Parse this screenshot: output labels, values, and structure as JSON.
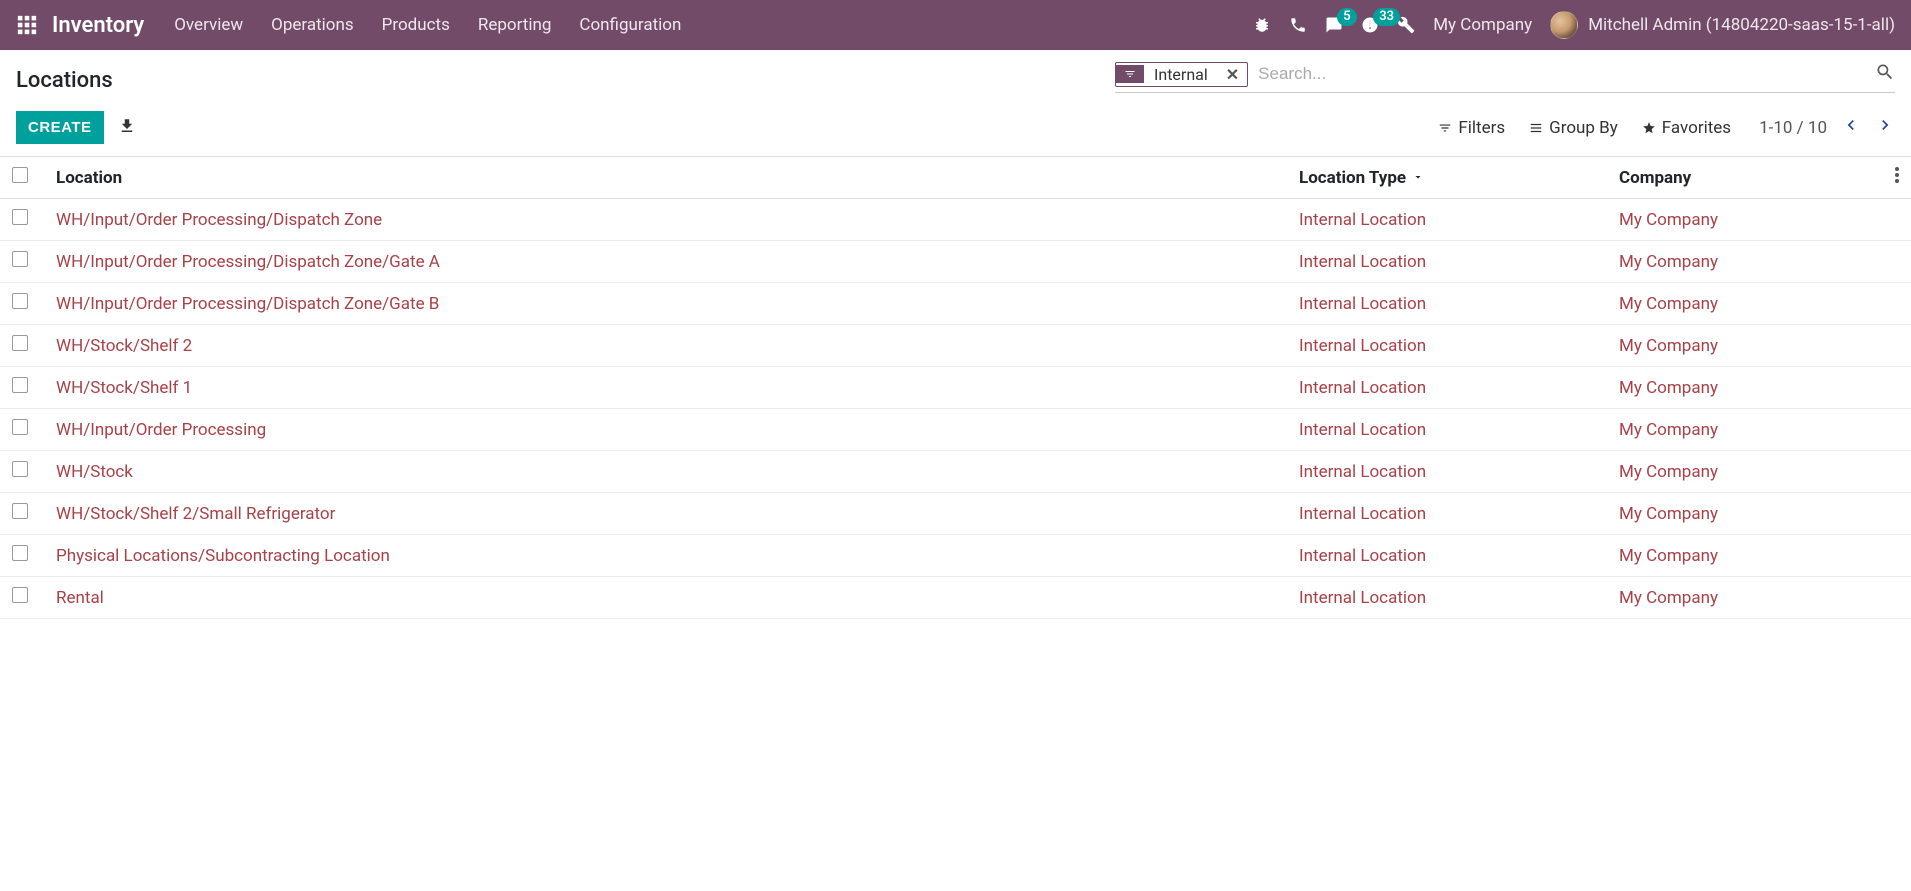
{
  "nav": {
    "brand": "Inventory",
    "menus": [
      "Overview",
      "Operations",
      "Products",
      "Reporting",
      "Configuration"
    ],
    "msg_count": "5",
    "activities_count": "33",
    "company": "My Company",
    "user": "Mitchell Admin (14804220-saas-15-1-all)"
  },
  "page": {
    "title": "Locations",
    "create_btn": "CREATE",
    "search_placeholder": "Search...",
    "facet_label": "Internal",
    "filters_label": "Filters",
    "groupby_label": "Group By",
    "favorites_label": "Favorites",
    "pager_text": "1-10 / 10"
  },
  "table": {
    "headers": {
      "location": "Location",
      "type": "Location Type",
      "company": "Company"
    },
    "rows": [
      {
        "location": "WH/Input/Order Processing/Dispatch Zone",
        "type": "Internal Location",
        "company": "My Company"
      },
      {
        "location": "WH/Input/Order Processing/Dispatch Zone/Gate A",
        "type": "Internal Location",
        "company": "My Company"
      },
      {
        "location": "WH/Input/Order Processing/Dispatch Zone/Gate B",
        "type": "Internal Location",
        "company": "My Company"
      },
      {
        "location": "WH/Stock/Shelf 2",
        "type": "Internal Location",
        "company": "My Company"
      },
      {
        "location": "WH/Stock/Shelf 1",
        "type": "Internal Location",
        "company": "My Company"
      },
      {
        "location": "WH/Input/Order Processing",
        "type": "Internal Location",
        "company": "My Company"
      },
      {
        "location": "WH/Stock",
        "type": "Internal Location",
        "company": "My Company"
      },
      {
        "location": "WH/Stock/Shelf 2/Small Refrigerator",
        "type": "Internal Location",
        "company": "My Company"
      },
      {
        "location": "Physical Locations/Subcontracting Location",
        "type": "Internal Location",
        "company": "My Company"
      },
      {
        "location": "Rental",
        "type": "Internal Location",
        "company": "My Company"
      }
    ]
  }
}
